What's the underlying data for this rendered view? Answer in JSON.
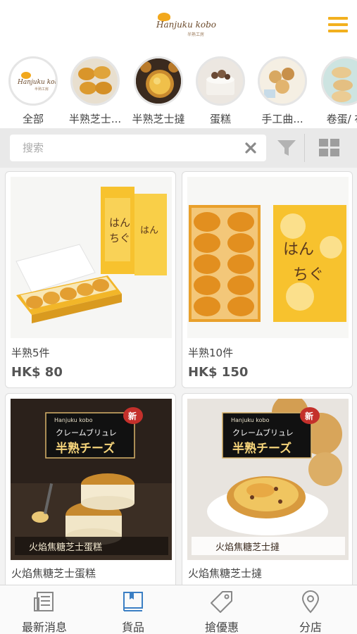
{
  "header": {
    "logo_text": "Hanjuku kobo",
    "logo_sub": "半熟工房",
    "menu_icon": "hamburger-menu-icon",
    "accent_color": "#f2b01e"
  },
  "categories": [
    {
      "label": "全部"
    },
    {
      "label": "半熟芝士..."
    },
    {
      "label": "半熟芝士撻"
    },
    {
      "label": "蛋糕"
    },
    {
      "label": "手工曲..."
    },
    {
      "label": "卷蛋/ 布"
    }
  ],
  "search": {
    "placeholder": "搜索",
    "value": "",
    "clear_icon": "close-icon",
    "filter_icon": "filter-icon",
    "layout_icon": "grid-view-icon"
  },
  "products": [
    {
      "name": "半熟5件",
      "price": "HK$ 80"
    },
    {
      "name": "半熟10件",
      "price": "HK$ 150"
    },
    {
      "name": "火焰焦糖芝士蛋糕",
      "price": "",
      "banner_brand": "Hanjuku kobo",
      "banner_title_jp": "クレームブリュレ",
      "banner_title": "半熟チーズ",
      "badge": "新",
      "caption": "火焰焦糖芝士蛋糕"
    },
    {
      "name": "火焰焦糖芝士撻",
      "price": "",
      "banner_brand": "Hanjuku kobo",
      "banner_title_jp": "クレームブリュレ",
      "banner_title": "半熟チーズ",
      "badge": "新",
      "caption": "火焰焦糖芝士撻"
    }
  ],
  "bottom_nav": [
    {
      "label": "最新消息",
      "icon": "news-icon",
      "active": false
    },
    {
      "label": "貨品",
      "icon": "book-icon",
      "active": true
    },
    {
      "label": "搶優惠",
      "icon": "tag-icon",
      "active": false
    },
    {
      "label": "分店",
      "icon": "location-pin-icon",
      "active": false
    }
  ],
  "colors": {
    "accent": "#f2b01e",
    "active_nav": "#3b7fc4"
  }
}
